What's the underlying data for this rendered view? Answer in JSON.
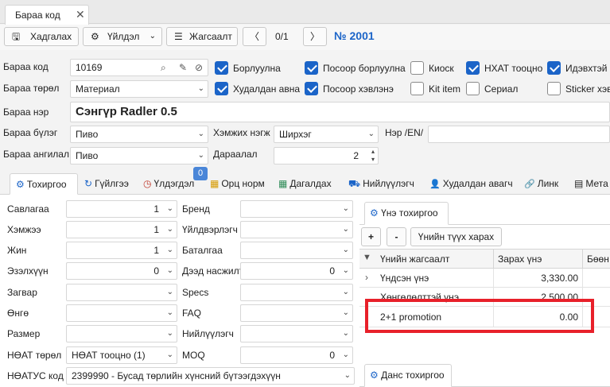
{
  "document_tab": {
    "title": "Бараа код",
    "close_glyph": "✕"
  },
  "toolbar": {
    "save_label": "Хадгалах",
    "actions_label": "Үйлдэл",
    "list_label": "Жагсаалт",
    "prev_glyph": "〈",
    "next_glyph": "〉",
    "pager": "0/1",
    "record_no": "№ 2001"
  },
  "form": {
    "code_label": "Бараа код",
    "code_value": "10169",
    "type_label": "Бараа төрөл",
    "type_value": "Материал",
    "name_label": "Бараа нэр",
    "name_value": "Сэнгүр Radler 0.5",
    "group_label": "Бараа бүлэг",
    "group_value": "Пиво",
    "category_label": "Бараа ангилал",
    "category_value": "Пиво",
    "unit_label": "Хэмжих нэгж",
    "unit_value": "Ширхэг",
    "sequence_label": "Дараалал",
    "sequence_value": "2",
    "name_en_label": "Нэр /EN/",
    "name_en_value": ""
  },
  "checkboxes": [
    {
      "label": "Борлуулна",
      "checked": true
    },
    {
      "label": "Посоор борлуулна",
      "checked": true
    },
    {
      "label": "Киоск",
      "checked": false
    },
    {
      "label": "НХАТ тооцно",
      "checked": true
    },
    {
      "label": "Идэвхтэй",
      "checked": true
    },
    {
      "label": "Худалдан авна",
      "checked": true
    },
    {
      "label": "Посоор хэвлэнэ",
      "checked": true
    },
    {
      "label": "Kit item",
      "checked": false
    },
    {
      "label": "Сериал",
      "checked": false
    },
    {
      "label": "Sticker хэвлэ",
      "checked": false
    }
  ],
  "tabs": [
    {
      "label": "Тохиргоо",
      "icon": "gear-icon",
      "glyph": "⚙"
    },
    {
      "label": "Гүйлгээ",
      "icon": "history-icon",
      "glyph": "↻"
    },
    {
      "label": "Үлдэгдэл",
      "icon": "clock-icon",
      "glyph": "◷",
      "badge": "0"
    },
    {
      "label": "Орц норм",
      "icon": "grid-icon",
      "glyph": "▦"
    },
    {
      "label": "Дагалдах",
      "icon": "items-icon",
      "glyph": "▦"
    },
    {
      "label": "Нийлүүлэгч",
      "icon": "truck-icon",
      "glyph": "⛟"
    },
    {
      "label": "Худалдан авагч",
      "icon": "user-icon",
      "glyph": "👤"
    },
    {
      "label": "Линк",
      "icon": "link-icon",
      "glyph": "🔗"
    },
    {
      "label": "Мета",
      "icon": "meta-icon",
      "glyph": "▤"
    }
  ],
  "settings_left": [
    {
      "label": "Савлагаа",
      "value": "1"
    },
    {
      "label": "Хэмжээ",
      "value": "1"
    },
    {
      "label": "Жин",
      "value": "1"
    },
    {
      "label": "Эзэлхүүн",
      "value": "0"
    },
    {
      "label": "Загвар",
      "value": ""
    },
    {
      "label": "Өнгө",
      "value": ""
    },
    {
      "label": "Размер",
      "value": ""
    },
    {
      "label": "НӨАТ төрөл",
      "value": "НӨАТ тооцно (1)"
    },
    {
      "label": "НӨАТУС код",
      "value": "2399990 - Бусад төрлийн хүнсний бүтээгдэхүүн"
    }
  ],
  "settings_mid": [
    {
      "label": "Бренд",
      "value": ""
    },
    {
      "label": "Үйлдвэрлэгч",
      "value": ""
    },
    {
      "label": "Баталгаа",
      "value": ""
    },
    {
      "label": "Дээд насжилт",
      "value": "0"
    },
    {
      "label": "Specs",
      "value": ""
    },
    {
      "label": "FAQ",
      "value": ""
    },
    {
      "label": "Нийлүүлэгч",
      "value": ""
    },
    {
      "label": "MOQ",
      "value": "0"
    }
  ],
  "price_panel": {
    "tab_label": "Үнэ тохиргоо",
    "add_label": "+",
    "remove_label": "-",
    "history_label": "Үнийн түүх харах",
    "columns": [
      "Үнийн жагсаалт",
      "Зарах үнэ",
      "Бөөн"
    ],
    "rows": [
      {
        "name": "Үндсэн үнэ",
        "price": "3,330.00"
      },
      {
        "name": "Хөнгөлөлттэй үнэ",
        "price": "2,500.00"
      },
      {
        "name": "2+1 promotion",
        "price": "0.00"
      }
    ],
    "highlight_color": "#e8202a"
  },
  "account_panel": {
    "tab_label": "Данс тохиргоо"
  },
  "colors": {
    "accent": "#1b64c8",
    "record_no": "#1b64c8"
  }
}
